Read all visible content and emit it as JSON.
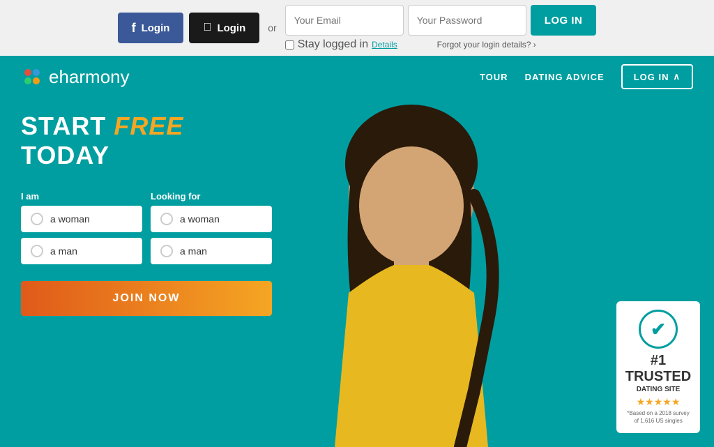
{
  "topbar": {
    "fb_login_label": "Login",
    "apple_login_label": "Login",
    "or_text": "or",
    "email_placeholder": "Your Email",
    "password_placeholder": "Your Password",
    "log_in_label": "LOG IN",
    "stay_logged_label": "Stay logged in",
    "details_label": "Details",
    "forgot_label": "Forgot your login details?",
    "forgot_arrow": "›"
  },
  "nav": {
    "logo_text": "eharmony",
    "tour_label": "TOUR",
    "dating_advice_label": "DATING ADVICE",
    "login_label": "LOG IN",
    "login_arrow": "∧"
  },
  "hero": {
    "headline_start": "START ",
    "headline_free": "free",
    "headline_end": " TODAY",
    "i_am_label": "I am",
    "looking_for_label": "Looking for",
    "options": [
      "a woman",
      "a man"
    ],
    "join_label": "JOIN NOW"
  },
  "trust": {
    "check_icon": "✔",
    "rank": "#1 TRUSTED",
    "site": "DATING SITE",
    "stars": "★★★★★",
    "sub_text": "*Based on a 2018 survey of 1,616 US singles"
  }
}
